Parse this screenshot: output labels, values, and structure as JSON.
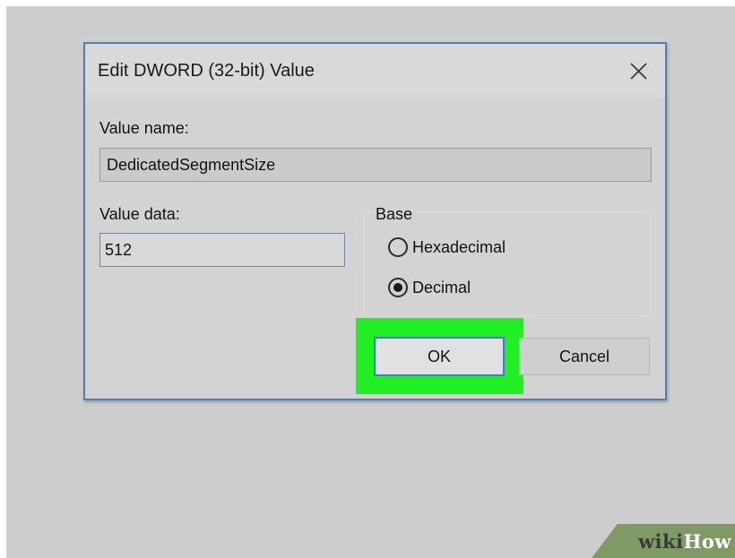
{
  "dialog": {
    "title": "Edit DWORD (32-bit) Value",
    "close_icon": "close-icon"
  },
  "value_name": {
    "label": "Value name:",
    "value": "DedicatedSegmentSize"
  },
  "value_data": {
    "label": "Value data:",
    "value": "512"
  },
  "base": {
    "title": "Base",
    "options": [
      {
        "label": "Hexadecimal",
        "selected": false
      },
      {
        "label": "Decimal",
        "selected": true
      }
    ]
  },
  "buttons": {
    "ok": "OK",
    "cancel": "Cancel"
  },
  "watermark": {
    "part1": "wiki",
    "part2": "How"
  },
  "colors": {
    "highlight": "#22ef22",
    "dialog_border": "#4d7fbb",
    "watermark_bg": "#7f9a65"
  }
}
